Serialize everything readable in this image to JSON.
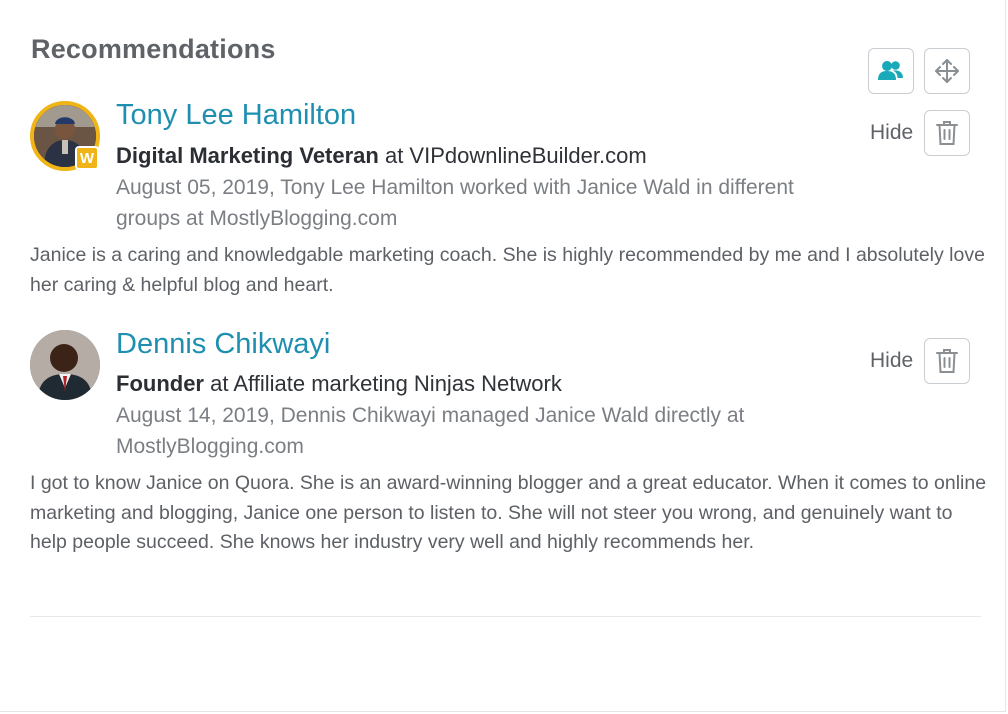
{
  "header": {
    "title": "Recommendations"
  },
  "toolbar": {
    "people_icon": "people-icon",
    "move_icon": "move-arrows-icon"
  },
  "recommendations": [
    {
      "name": "Tony Lee Hamilton",
      "title": "Digital Marketing Veteran",
      "at": " at VIPdownlineBuilder.com",
      "meta": "August 05, 2019, Tony Lee Hamilton worked with Janice Wald in different groups at MostlyBlogging.com",
      "body": "Janice is a caring and knowledgable marketing coach. She is highly recommended by me and I absolutely love her caring & helpful blog and heart.",
      "hide_label": "Hide",
      "badge": "W"
    },
    {
      "name": "Dennis Chikwayi",
      "title": "Founder",
      "at": " at Affiliate marketing Ninjas Network",
      "meta": "August 14, 2019, Dennis Chikwayi managed Janice Wald directly at MostlyBlogging.com",
      "body": "I got to know Janice on Quora. She is an award-winning blogger and a great educator. When it comes to online marketing and blogging, Janice one person to listen to. She will not steer you wrong, and genuinely want to help people succeed. She knows her industry very well and highly recommends her.",
      "hide_label": "Hide"
    }
  ],
  "colors": {
    "accent": "#1e8fb0",
    "icon_teal": "#1aa9b8",
    "badge": "#f0b416"
  }
}
